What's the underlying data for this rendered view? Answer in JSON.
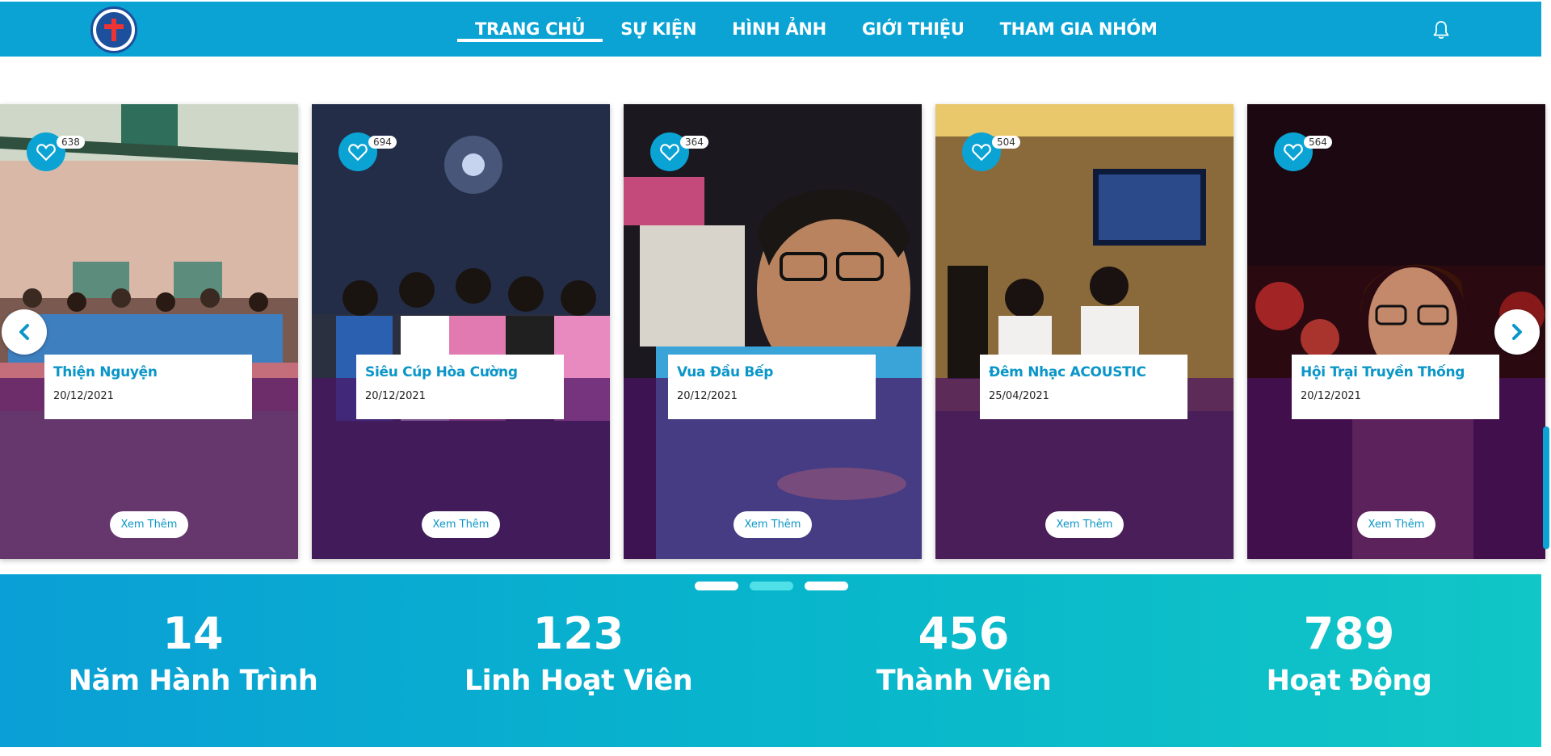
{
  "nav": {
    "items": [
      {
        "label": "TRANG CHỦ",
        "active": true
      },
      {
        "label": "SỰ KIỆN",
        "active": false
      },
      {
        "label": "HÌNH ẢNH",
        "active": false
      },
      {
        "label": "GIỚI THIỆU",
        "active": false
      },
      {
        "label": "THAM GIA NHÓM",
        "active": false
      }
    ],
    "logo_icon": "parish-logo-icon",
    "bell_icon": "bell-icon"
  },
  "cards": [
    {
      "title": "Thiện Nguyện",
      "date": "20/12/2021",
      "likes": "638",
      "button": "Xem Thêm"
    },
    {
      "title": "Siêu Cúp Hòa Cường",
      "date": "20/12/2021",
      "likes": "694",
      "button": "Xem Thêm"
    },
    {
      "title": "Vua Đầu Bếp",
      "date": "20/12/2021",
      "likes": "364",
      "button": "Xem Thêm"
    },
    {
      "title": "Đêm Nhạc ACOUSTIC",
      "date": "25/04/2021",
      "likes": "504",
      "button": "Xem Thêm"
    },
    {
      "title": "Hội Trại Truyền Thống",
      "date": "20/12/2021",
      "likes": "564",
      "button": "Xem Thêm"
    }
  ],
  "carousel": {
    "prev_icon": "chevron-left-icon",
    "next_icon": "chevron-right-icon",
    "page_count": 3,
    "active_page": 2
  },
  "stats": [
    {
      "number": "14",
      "label": "Năm Hành Trình"
    },
    {
      "number": "123",
      "label": "Linh Hoạt Viên"
    },
    {
      "number": "456",
      "label": "Thành Viên"
    },
    {
      "number": "789",
      "label": "Hoạt Động"
    }
  ],
  "colors": {
    "primary": "#0aa3d4",
    "accent": "#0a96c8",
    "overlay": "#4b1464"
  }
}
